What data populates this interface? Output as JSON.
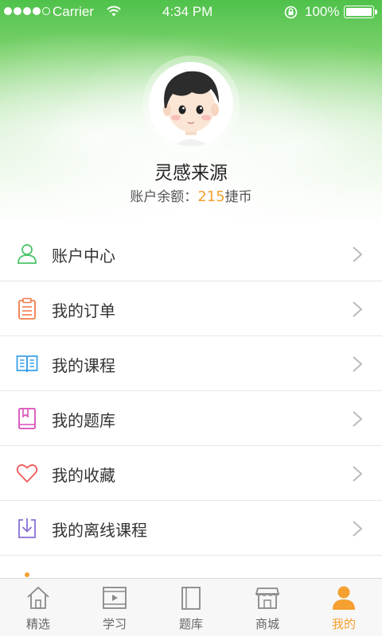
{
  "status_bar": {
    "carrier": "Carrier",
    "time": "4:34 PM",
    "battery": "100%"
  },
  "profile": {
    "name": "灵感来源",
    "balance_label": "账户余额：",
    "balance_amount": "215",
    "balance_unit": "捷币"
  },
  "menu": [
    {
      "label": "账户中心",
      "icon": "person-icon",
      "color": "#4cc46a"
    },
    {
      "label": "我的订单",
      "icon": "clipboard-icon",
      "color": "#f07c4a"
    },
    {
      "label": "我的课程",
      "icon": "open-book-icon",
      "color": "#3aa0e8"
    },
    {
      "label": "我的题库",
      "icon": "bookmark-book-icon",
      "color": "#d94fb7"
    },
    {
      "label": "我的收藏",
      "icon": "heart-icon",
      "color": "#f05a5a"
    },
    {
      "label": "我的离线课程",
      "icon": "download-icon",
      "color": "#8a6fd6"
    }
  ],
  "tabs": [
    {
      "label": "精选",
      "icon": "home-icon",
      "active": false
    },
    {
      "label": "学习",
      "icon": "video-icon",
      "active": false
    },
    {
      "label": "题库",
      "icon": "book-icon",
      "active": false
    },
    {
      "label": "商城",
      "icon": "store-icon",
      "active": false
    },
    {
      "label": "我的",
      "icon": "user-icon",
      "active": true
    }
  ],
  "colors": {
    "accent": "#f5a031",
    "header_green": "#4fc24b"
  }
}
